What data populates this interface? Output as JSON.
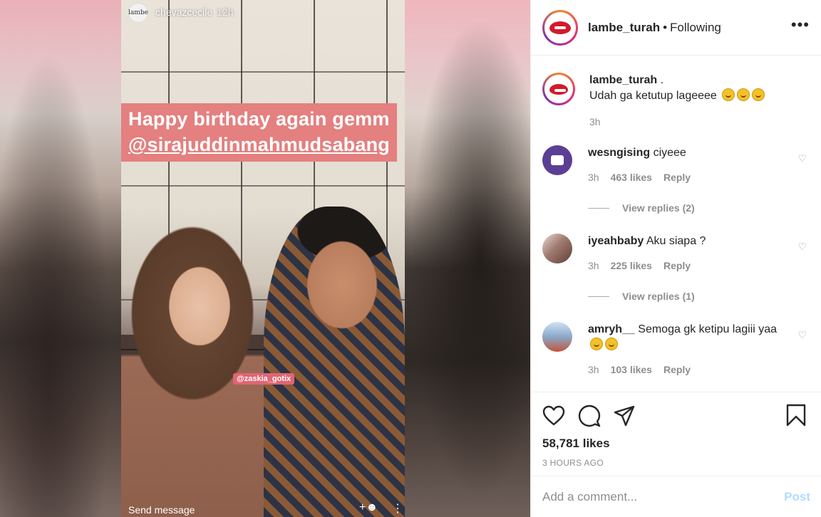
{
  "story": {
    "username": "chevazcecile",
    "time": "12h",
    "avatar_text": "lambe",
    "caption_line1": "Happy birthday again gemm",
    "caption_mention": "@sirajuddinmahmudsabang",
    "tag": "@zaskia_gotix",
    "footer_text": "Send message",
    "add_icon": "add-person-icon",
    "more_icon": "more-vertical-icon"
  },
  "header": {
    "username": "lambe_turah",
    "separator": "•",
    "status": "Following",
    "more_icon": "more-horizontal-icon"
  },
  "caption": {
    "username": "lambe_turah",
    "suffix": ".",
    "text": "Udah ga ketutup lageeee",
    "emojis": 3,
    "time": "3h"
  },
  "comments": [
    {
      "username": "wesngising",
      "text": "ciyeee",
      "time": "3h",
      "likes": "463 likes",
      "reply": "Reply",
      "view_replies": "View replies (2)",
      "avatar_color": "#5b3f95"
    },
    {
      "username": "iyeahbaby",
      "text": "Aku siapa ?",
      "time": "3h",
      "likes": "225 likes",
      "reply": "Reply",
      "view_replies": "View replies (1)",
      "avatar_color": "#a07a70"
    },
    {
      "username": "amryh__",
      "text": "Semoga gk ketipu lagiii yaa",
      "time": "3h",
      "likes": "103 likes",
      "reply": "Reply",
      "avatar_color": "#8aa8c8"
    }
  ],
  "actions": {
    "like_icon": "heart-icon",
    "comment_icon": "comment-icon",
    "share_icon": "paper-plane-icon",
    "save_icon": "bookmark-icon",
    "likes_count": "58,781 likes",
    "time_ago": "3 HOURS AGO"
  },
  "add_comment": {
    "placeholder": "Add a comment...",
    "post_label": "Post"
  }
}
